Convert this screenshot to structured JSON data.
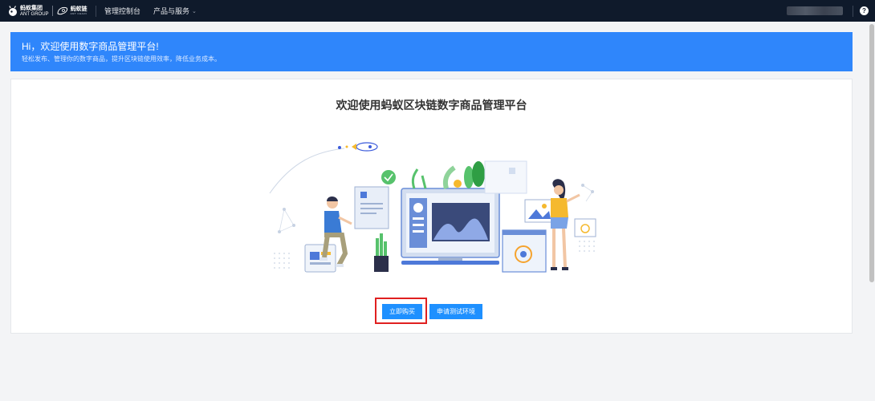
{
  "topnav": {
    "brand_cn": "蚂蚁集团",
    "brand_en": "ANT GROUP",
    "chain_cn": "蚂蚁链",
    "chain_en": "ANT CHAIN",
    "items": [
      {
        "label": "管理控制台"
      },
      {
        "label": "产品与服务",
        "chevron": "⌄"
      }
    ],
    "help_icon": "?"
  },
  "banner": {
    "title": "Hi，欢迎使用数字商品管理平台!",
    "subtitle": "轻松发布、管理你的数字商品，提升区块链使用效率，降低业务成本。"
  },
  "card": {
    "title": "欢迎使用蚂蚁区块链数字商品管理平台",
    "buy_button": "立即购买",
    "trial_button": "申请测试环境"
  },
  "colors": {
    "nav_bg": "#0f1a2b",
    "banner_bg": "#2f86fb",
    "button_bg": "#1e90ff",
    "highlight": "#e02020"
  }
}
